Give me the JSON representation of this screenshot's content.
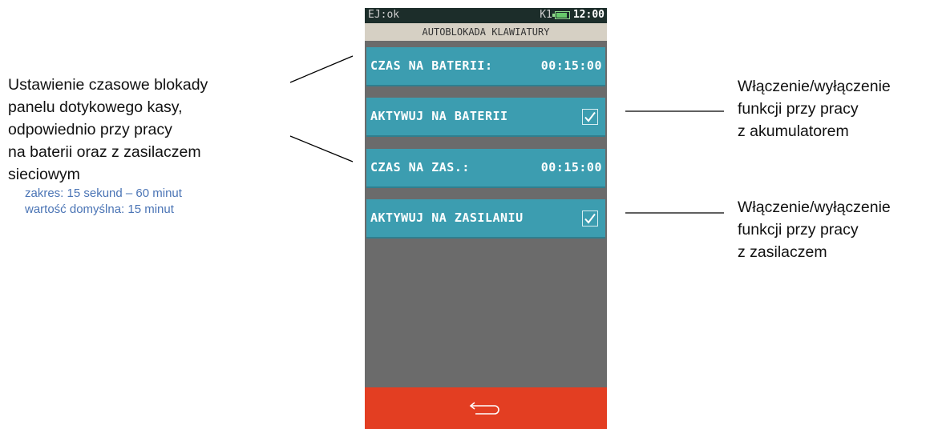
{
  "annotations": {
    "left": {
      "lines": [
        "Ustawienie czasowe blokady",
        "panelu dotykowego kasy,",
        "odpowiednio przy pracy",
        "na  baterii oraz z zasilaczem",
        "sieciowym"
      ],
      "range": "zakres: 15 sekund – 60 minut",
      "default": "wartość domyślna: 15 minut"
    },
    "right_battery": {
      "lines": [
        "Włączenie/wyłączenie",
        "funkcji przy pracy",
        "z akumulatorem"
      ]
    },
    "right_power": {
      "lines": [
        "Włączenie/wyłączenie",
        "funkcji przy pracy",
        "z zasilaczem"
      ]
    }
  },
  "device": {
    "status": {
      "left": "EJ:ok",
      "indicator": "K1",
      "clock": "12:00",
      "battery_icon": "battery-icon"
    },
    "title": "AUTOBLOKADA KLAWIATURY",
    "rows": [
      {
        "label": "CZAS NA BATERII:",
        "value": "00:15:00"
      },
      {
        "label": "AKTYWUJ NA BATERII",
        "checked": true
      },
      {
        "label": "CZAS NA ZAS.:",
        "value": "00:15:00"
      },
      {
        "label": "AKTYWUJ NA ZASILANIU",
        "checked": true
      }
    ],
    "back_icon": "return-arrow-icon"
  },
  "colors": {
    "row_bg": "#3c9db0",
    "back_bar": "#e33e22",
    "status_bar": "#1c2d2a",
    "title_bar": "#d6d0c4",
    "empty_area": "#6b6b6b",
    "hint_text": "#4a74b5"
  }
}
